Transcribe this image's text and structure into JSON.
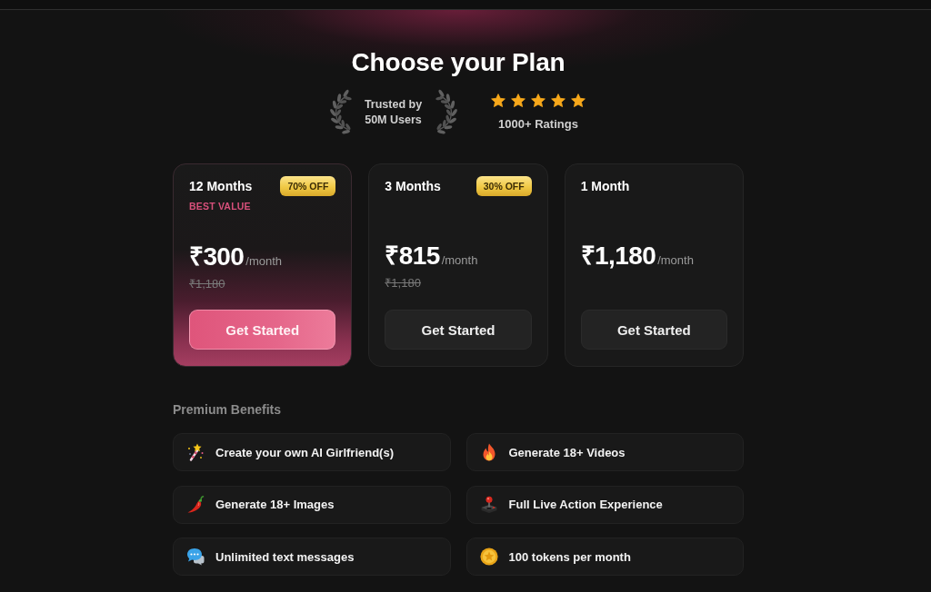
{
  "title": "Choose your Plan",
  "trust": {
    "text": "Trusted by 50M Users"
  },
  "rating": {
    "stars": 5,
    "label": "1000+ Ratings"
  },
  "plans": [
    {
      "name": "12 Months",
      "discount": "70% OFF",
      "tag": "BEST VALUE",
      "price": "₹300",
      "period": "/month",
      "original_price": "₹1,180",
      "button": "Get Started",
      "selected": true
    },
    {
      "name": "3 Months",
      "discount": "30% OFF",
      "price": "₹815",
      "period": "/month",
      "original_price": "₹1,180",
      "button": "Get Started",
      "selected": false
    },
    {
      "name": "1 Month",
      "price": "₹1,180",
      "period": "/month",
      "button": "Get Started",
      "selected": false
    }
  ],
  "benefits": {
    "title": "Premium Benefits",
    "items": [
      {
        "label": "Create your own AI Girlfriend(s)"
      },
      {
        "label": "Generate 18+ Videos"
      },
      {
        "label": "Generate 18+ Images"
      },
      {
        "label": "Full Live Action Experience"
      },
      {
        "label": "Unlimited text messages"
      },
      {
        "label": "100 tokens per month"
      }
    ]
  }
}
